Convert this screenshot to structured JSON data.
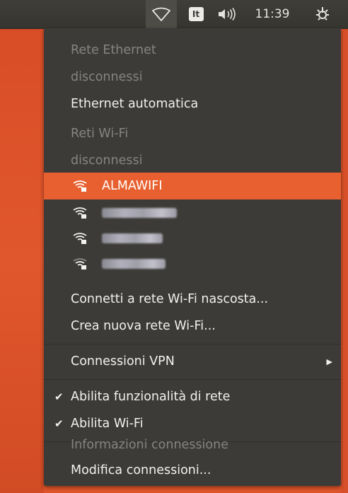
{
  "panel": {
    "keyboard_layout": "It",
    "clock": "11:39",
    "icons": [
      "wifi-icon",
      "volume-icon",
      "system-gear-icon"
    ]
  },
  "menu": {
    "ethernet_header": "Rete Ethernet",
    "ethernet_status": "disconnessi",
    "ethernet_auto": "Ethernet automatica",
    "wifi_header": "Reti Wi-Fi",
    "wifi_status": "disconnessi",
    "networks": [
      {
        "name": "ALMAWIFI",
        "selected": true
      },
      {
        "name": "",
        "obscured": true
      },
      {
        "name": "",
        "obscured": true
      },
      {
        "name": "",
        "obscured": true
      }
    ],
    "connect_hidden": "Connetti a rete Wi-Fi nascosta...",
    "create_new": "Crea nuova rete Wi-Fi...",
    "vpn": "Connessioni VPN",
    "enable_networking": "Abilita funzionalità di rete",
    "enable_wifi": "Abilita Wi-Fi",
    "connection_info": "Informazioni connessione",
    "edit_connections": "Modifica connessioni..."
  },
  "colors": {
    "highlight": "#e8602f",
    "menu_bg": "#3c3b37",
    "desktop": "#e0542a"
  }
}
